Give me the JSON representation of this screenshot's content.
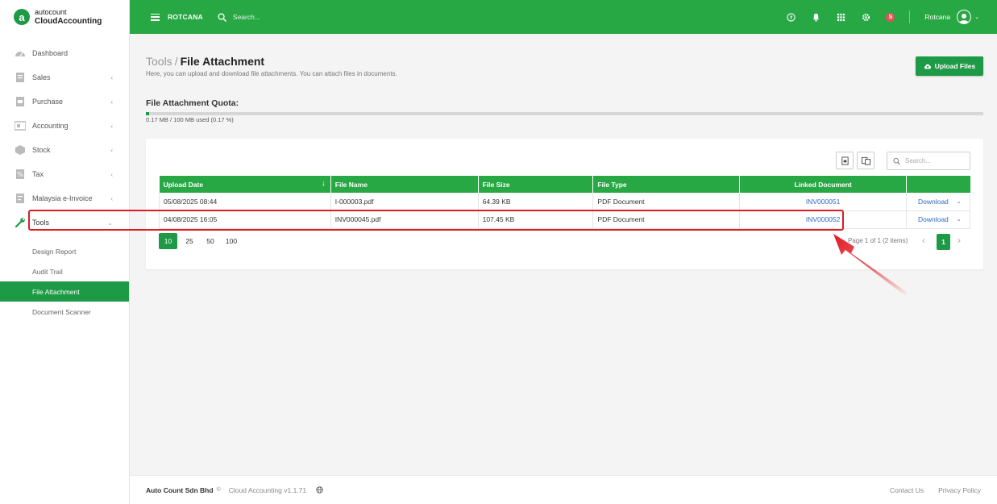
{
  "brand": {
    "top": "autocount",
    "bottom": "CloudAccounting",
    "mark": "a"
  },
  "sidebar": {
    "items": [
      {
        "label": "Dashboard",
        "icon": "dashboard-icon",
        "chevron": ""
      },
      {
        "label": "Sales",
        "icon": "sales-icon",
        "chevron": "‹"
      },
      {
        "label": "Purchase",
        "icon": "purchase-icon",
        "chevron": "‹"
      },
      {
        "label": "Accounting",
        "icon": "accounting-icon",
        "chevron": "‹"
      },
      {
        "label": "Stock",
        "icon": "stock-icon",
        "chevron": "‹"
      },
      {
        "label": "Tax",
        "icon": "tax-icon",
        "chevron": "‹"
      },
      {
        "label": "Malaysia e-Invoice",
        "icon": "einvoice-icon",
        "chevron": "‹"
      },
      {
        "label": "Tools",
        "icon": "wrench-icon",
        "chevron": "⌄"
      }
    ],
    "subitems": [
      {
        "label": "Design Report"
      },
      {
        "label": "Audit Trail"
      },
      {
        "label": "File Attachment"
      },
      {
        "label": "Document Scanner"
      }
    ]
  },
  "topbar": {
    "company": "ROTCANA",
    "search_placeholder": "Search...",
    "badge": "S",
    "user": "Rotcana",
    "accent": "#28a745"
  },
  "page": {
    "crumb_parent": "Tools",
    "crumb_sep": "/",
    "title": "File Attachment",
    "subtitle": "Here, you can upload and download file attachments. You can attach files in documents.",
    "upload_label": "Upload Files"
  },
  "quota": {
    "title": "File Attachment Quota:",
    "text": "0.17 MB / 100 MB used (0.17 %)",
    "used_fraction": 0.0017
  },
  "table": {
    "search_placeholder": "Search...",
    "columns": [
      "Upload Date",
      "File Name",
      "File Size",
      "File Type",
      "Linked Document",
      ""
    ],
    "sort_icon": "↓",
    "rows": [
      {
        "date": "05/08/2025 08:44",
        "name": "I-000003.pdf",
        "size": "64.39 KB",
        "type": "PDF Document",
        "linked": "INV000051",
        "action": "Download"
      },
      {
        "date": "04/08/2025 16:05",
        "name": "INV000045.pdf",
        "size": "107.45 KB",
        "type": "PDF Document",
        "linked": "INV000052",
        "action": "Download"
      }
    ]
  },
  "pager": {
    "sizes": [
      "10",
      "25",
      "50",
      "100"
    ],
    "info": "Page 1 of 1 (2 items)",
    "current": "1",
    "prev": "‹",
    "next": "›"
  },
  "footer": {
    "company": "Auto Count Sdn Bhd",
    "copyright": "©",
    "version": "Cloud Accounting v1.1.71",
    "links": [
      "Contact Us",
      "Privacy Policy"
    ]
  },
  "colors": {
    "primary": "#1e9a46",
    "highlight": "#e01b24",
    "link": "#2b6cc4"
  }
}
